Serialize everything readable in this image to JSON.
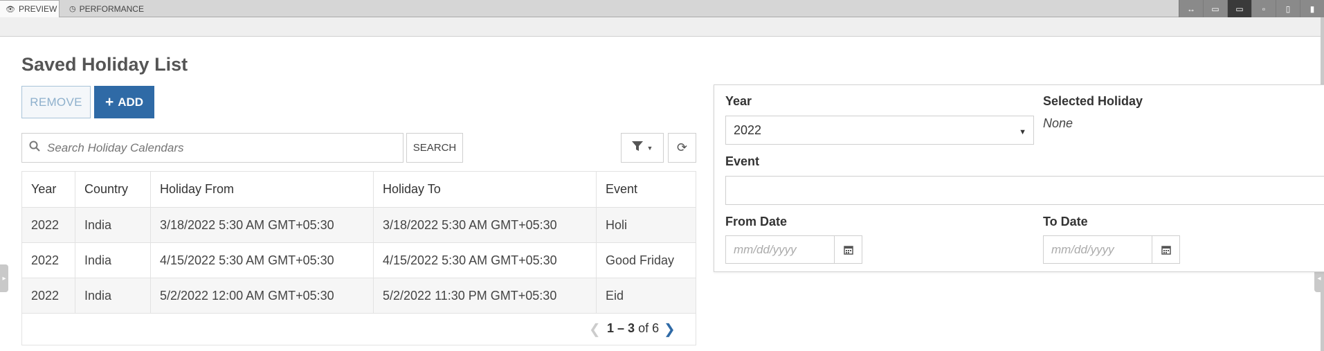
{
  "preview_bar": {
    "tabs": [
      {
        "label": "PREVIEW",
        "icon": "eye-icon"
      },
      {
        "label": "PERFORMANCE",
        "icon": "gauge-icon"
      }
    ],
    "devices": [
      "fit-width-icon",
      "desktop-wide-icon",
      "desktop-icon",
      "laptop-icon",
      "tablet-icon",
      "mobile-icon"
    ],
    "selected_device": "desktop-icon"
  },
  "page": {
    "title": "Saved Holiday List"
  },
  "toolbar": {
    "remove_label": "REMOVE",
    "add_label": "ADD",
    "search_placeholder": "Search Holiday Calendars",
    "search_button_label": "SEARCH"
  },
  "table": {
    "columns": [
      "Year",
      "Country",
      "Holiday From",
      "Holiday To",
      "Event"
    ],
    "rows": [
      {
        "year": "2022",
        "country": "India",
        "from": "3/18/2022 5:30 AM GMT+05:30",
        "to": "3/18/2022 5:30 AM GMT+05:30",
        "event": "Holi"
      },
      {
        "year": "2022",
        "country": "India",
        "from": "4/15/2022 5:30 AM GMT+05:30",
        "to": "4/15/2022 5:30 AM GMT+05:30",
        "event": "Good Friday"
      },
      {
        "year": "2022",
        "country": "India",
        "from": "5/2/2022 12:00 AM GMT+05:30",
        "to": "5/2/2022 11:30 PM GMT+05:30",
        "event": "Eid"
      }
    ]
  },
  "pager": {
    "range": "1 – 3",
    "of_text": "of 6"
  },
  "form": {
    "year_label": "Year",
    "year_value": "2022",
    "selected_holiday_label": "Selected Holiday",
    "selected_holiday_value": "None",
    "event_label": "Event",
    "event_value": "",
    "from_date_label": "From Date",
    "from_date_placeholder": "mm/dd/yyyy",
    "to_date_label": "To Date",
    "to_date_placeholder": "mm/dd/yyyy"
  },
  "colors": {
    "primary": "#2f6aa6",
    "remove_text": "#8eb0cc",
    "top_bar": "#d6d6d6"
  }
}
